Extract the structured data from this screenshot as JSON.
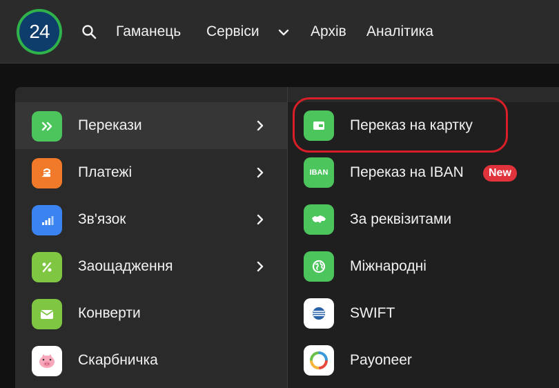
{
  "header": {
    "logo_text": "24",
    "nav": [
      "Гаманець",
      "Сервіси",
      "Архів",
      "Аналітика"
    ]
  },
  "left_menu": [
    {
      "label": "Перекази",
      "icon": "double-chevron-icon",
      "color": "#4cc65c",
      "has_submenu": true,
      "active": true
    },
    {
      "label": "Платежі",
      "icon": "hryvnia-icon",
      "color": "#f07a2a",
      "has_submenu": true
    },
    {
      "label": "Зв'язок",
      "icon": "signal-bars-icon",
      "color": "#3b83f0",
      "has_submenu": true
    },
    {
      "label": "Заощадження",
      "icon": "percent-icon",
      "color": "#7fc642",
      "has_submenu": true
    },
    {
      "label": "Конверти",
      "icon": "envelope-icon",
      "color": "#7fc642",
      "has_submenu": false
    },
    {
      "label": "Скарбничка",
      "icon": "piggy-bank-icon",
      "color": "#ffffff",
      "has_submenu": false
    }
  ],
  "right_menu": [
    {
      "label": "Переказ на картку",
      "icon": "card-icon",
      "color": "#4cc65c",
      "highlighted": true
    },
    {
      "label": "Переказ на IBAN",
      "icon": "iban-icon",
      "icon_text": "IBAN",
      "color": "#4cc65c",
      "badge": "New"
    },
    {
      "label": "За реквізитами",
      "icon": "ukraine-map-icon",
      "color": "#4cc65c"
    },
    {
      "label": "Міжнародні",
      "icon": "globe-icon",
      "color": "#4cc65c"
    },
    {
      "label": "SWIFT",
      "icon": "swift-icon",
      "color": "#ffffff"
    },
    {
      "label": "Payoneer",
      "icon": "payoneer-icon",
      "color": "#ffffff"
    }
  ],
  "colors": {
    "highlight": "#d81e27",
    "badge": "#e0333b",
    "brand_green": "#2fb24a",
    "brand_blue": "#0e3c6b"
  }
}
